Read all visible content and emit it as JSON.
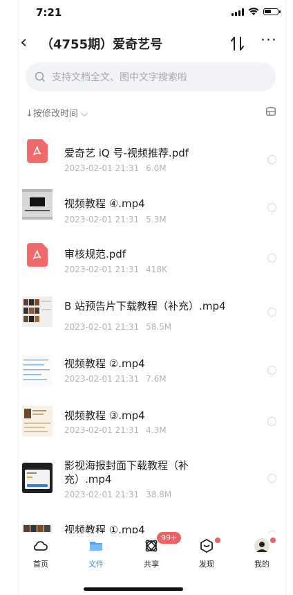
{
  "status": {
    "time": "7:21"
  },
  "nav": {
    "title": "（4755期）爱奇艺号"
  },
  "search": {
    "placeholder": "支持文档全文、图中文字搜索啦"
  },
  "sort": {
    "label": "↓按修改时间 ⌵"
  },
  "files": [
    {
      "name": "爱奇艺 iQ 号-视频推荐.pdf",
      "date": "2023-02-01 21:31",
      "size": "6.0M",
      "type": "pdf"
    },
    {
      "name": "视频教程 ④.mp4",
      "date": "2023-02-01 21:31",
      "size": "5.3M",
      "type": "video"
    },
    {
      "name": "审核规范.pdf",
      "date": "2023-02-01 21:31",
      "size": "418K",
      "type": "pdf"
    },
    {
      "name": "B 站预告片下载教程（补充）.mp4",
      "date": "2023-02-01 21:31",
      "size": "58.5M",
      "type": "video"
    },
    {
      "name": "视频教程 ②.mp4",
      "date": "2023-02-01 21:31",
      "size": "7.6M",
      "type": "video"
    },
    {
      "name": "视频教程 ③.mp4",
      "date": "2023-02-01 21:31",
      "size": "4.3M",
      "type": "video"
    },
    {
      "name": "影视海报封面下载教程（补充）.mp4",
      "date": "2023-02-01 21:31",
      "size": "38.8M",
      "type": "video"
    },
    {
      "name": "视频教程 ①.mp4",
      "date": "",
      "size": "",
      "type": "video"
    }
  ],
  "tabs": [
    {
      "label": "首页",
      "icon": "cloud-icon"
    },
    {
      "label": "文件",
      "icon": "folder-icon"
    },
    {
      "label": "共享",
      "icon": "share-icon",
      "badge": "99+"
    },
    {
      "label": "发现",
      "icon": "discover-icon"
    },
    {
      "label": "我的",
      "icon": "avatar-icon"
    }
  ],
  "colors": {
    "accent": "#3b8cf5",
    "pdf": "#f06a6a",
    "badge": "#f06060"
  }
}
